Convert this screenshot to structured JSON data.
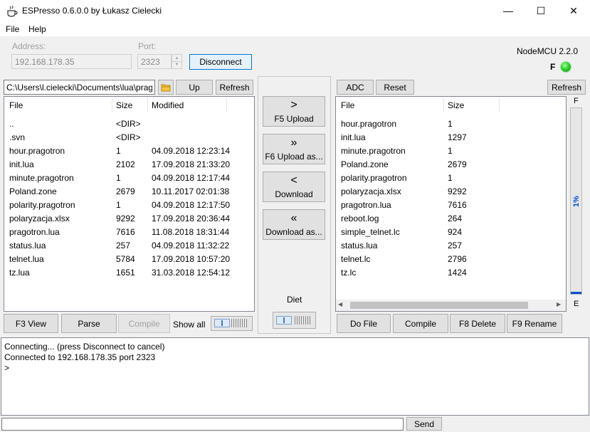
{
  "window": {
    "title": "ESPresso 0.6.0.0 by Łukasz Cielecki",
    "minimize": "—",
    "maximize": "☐",
    "close": "✕"
  },
  "menu": {
    "file": "File",
    "help": "Help"
  },
  "connection": {
    "address_label": "Address:",
    "address_value": "192.168.178.35",
    "port_label": "Port:",
    "port_value": "2323",
    "disconnect_label": "Disconnect"
  },
  "device": {
    "firmware": "NodeMCU 2.2.0",
    "flag": "F",
    "led_color": "#2fd02c"
  },
  "local": {
    "path": "C:\\Users\\l.cielecki\\Documents\\lua\\prag",
    "up_label": "Up",
    "refresh_label": "Refresh",
    "columns": {
      "file": "File",
      "size": "Size",
      "modified": "Modified"
    },
    "rows": [
      {
        "file": "..",
        "size": "<DIR>",
        "modified": ""
      },
      {
        "file": ".svn",
        "size": "<DIR>",
        "modified": ""
      },
      {
        "file": "hour.pragotron",
        "size": "1",
        "modified": "04.09.2018 12:23:14"
      },
      {
        "file": "init.lua",
        "size": "2102",
        "modified": "17.09.2018 21:33:20"
      },
      {
        "file": "minute.pragotron",
        "size": "1",
        "modified": "04.09.2018 12:17:44"
      },
      {
        "file": "Poland.zone",
        "size": "2679",
        "modified": "10.11.2017 02:01:38"
      },
      {
        "file": "polarity.pragotron",
        "size": "1",
        "modified": "04.09.2018 12:17:50"
      },
      {
        "file": "polaryzacja.xlsx",
        "size": "9292",
        "modified": "17.09.2018 20:36:44"
      },
      {
        "file": "pragotron.lua",
        "size": "7616",
        "modified": "11.08.2018 18:31:44"
      },
      {
        "file": "status.lua",
        "size": "257",
        "modified": "04.09.2018 11:32:22"
      },
      {
        "file": "telnet.lua",
        "size": "5784",
        "modified": "17.09.2018 10:57:20"
      },
      {
        "file": "tz.lua",
        "size": "1651",
        "modified": "31.03.2018 12:54:12"
      }
    ],
    "buttons": {
      "view": "F3 View",
      "parse": "Parse",
      "compile": "Compile",
      "show_all": "Show all"
    }
  },
  "transfer": {
    "upload": {
      "arrow": ">",
      "label": "F5 Upload"
    },
    "upload_as": {
      "arrow": "»",
      "label": "F6 Upload as..."
    },
    "download": {
      "arrow": "<",
      "label": "Download"
    },
    "download_as": {
      "arrow": "«",
      "label": "Download as..."
    },
    "diet_label": "Diet"
  },
  "remote": {
    "adc_label": "ADC",
    "reset_label": "Reset",
    "refresh_label": "Refresh",
    "columns": {
      "file": "File",
      "size": "Size"
    },
    "rows": [
      {
        "file": "hour.pragotron",
        "size": "1"
      },
      {
        "file": "init.lua",
        "size": "1297"
      },
      {
        "file": "minute.pragotron",
        "size": "1"
      },
      {
        "file": "Poland.zone",
        "size": "2679"
      },
      {
        "file": "polarity.pragotron",
        "size": "1"
      },
      {
        "file": "polaryzacja.xlsx",
        "size": "9292"
      },
      {
        "file": "pragotron.lua",
        "size": "7616"
      },
      {
        "file": "reboot.log",
        "size": "264"
      },
      {
        "file": "simple_telnet.lc",
        "size": "924"
      },
      {
        "file": "status.lua",
        "size": "257"
      },
      {
        "file": "telnet.lc",
        "size": "2796"
      },
      {
        "file": "tz.lc",
        "size": "1424"
      }
    ],
    "buttons": {
      "do_file": "Do File",
      "compile": "Compile",
      "delete": "F8 Delete",
      "rename": "F9 Rename"
    },
    "scroll_left": "◀",
    "scroll_right": "▶"
  },
  "memory": {
    "full_label": "F",
    "empty_label": "E",
    "percent_label": "1%",
    "fill_fraction": 0.01
  },
  "console": {
    "lines": [
      "Connecting... (press Disconnect to cancel)",
      "Connected to 192.168.178.35 port 2323",
      ">"
    ],
    "input_value": "",
    "send_label": "Send"
  }
}
